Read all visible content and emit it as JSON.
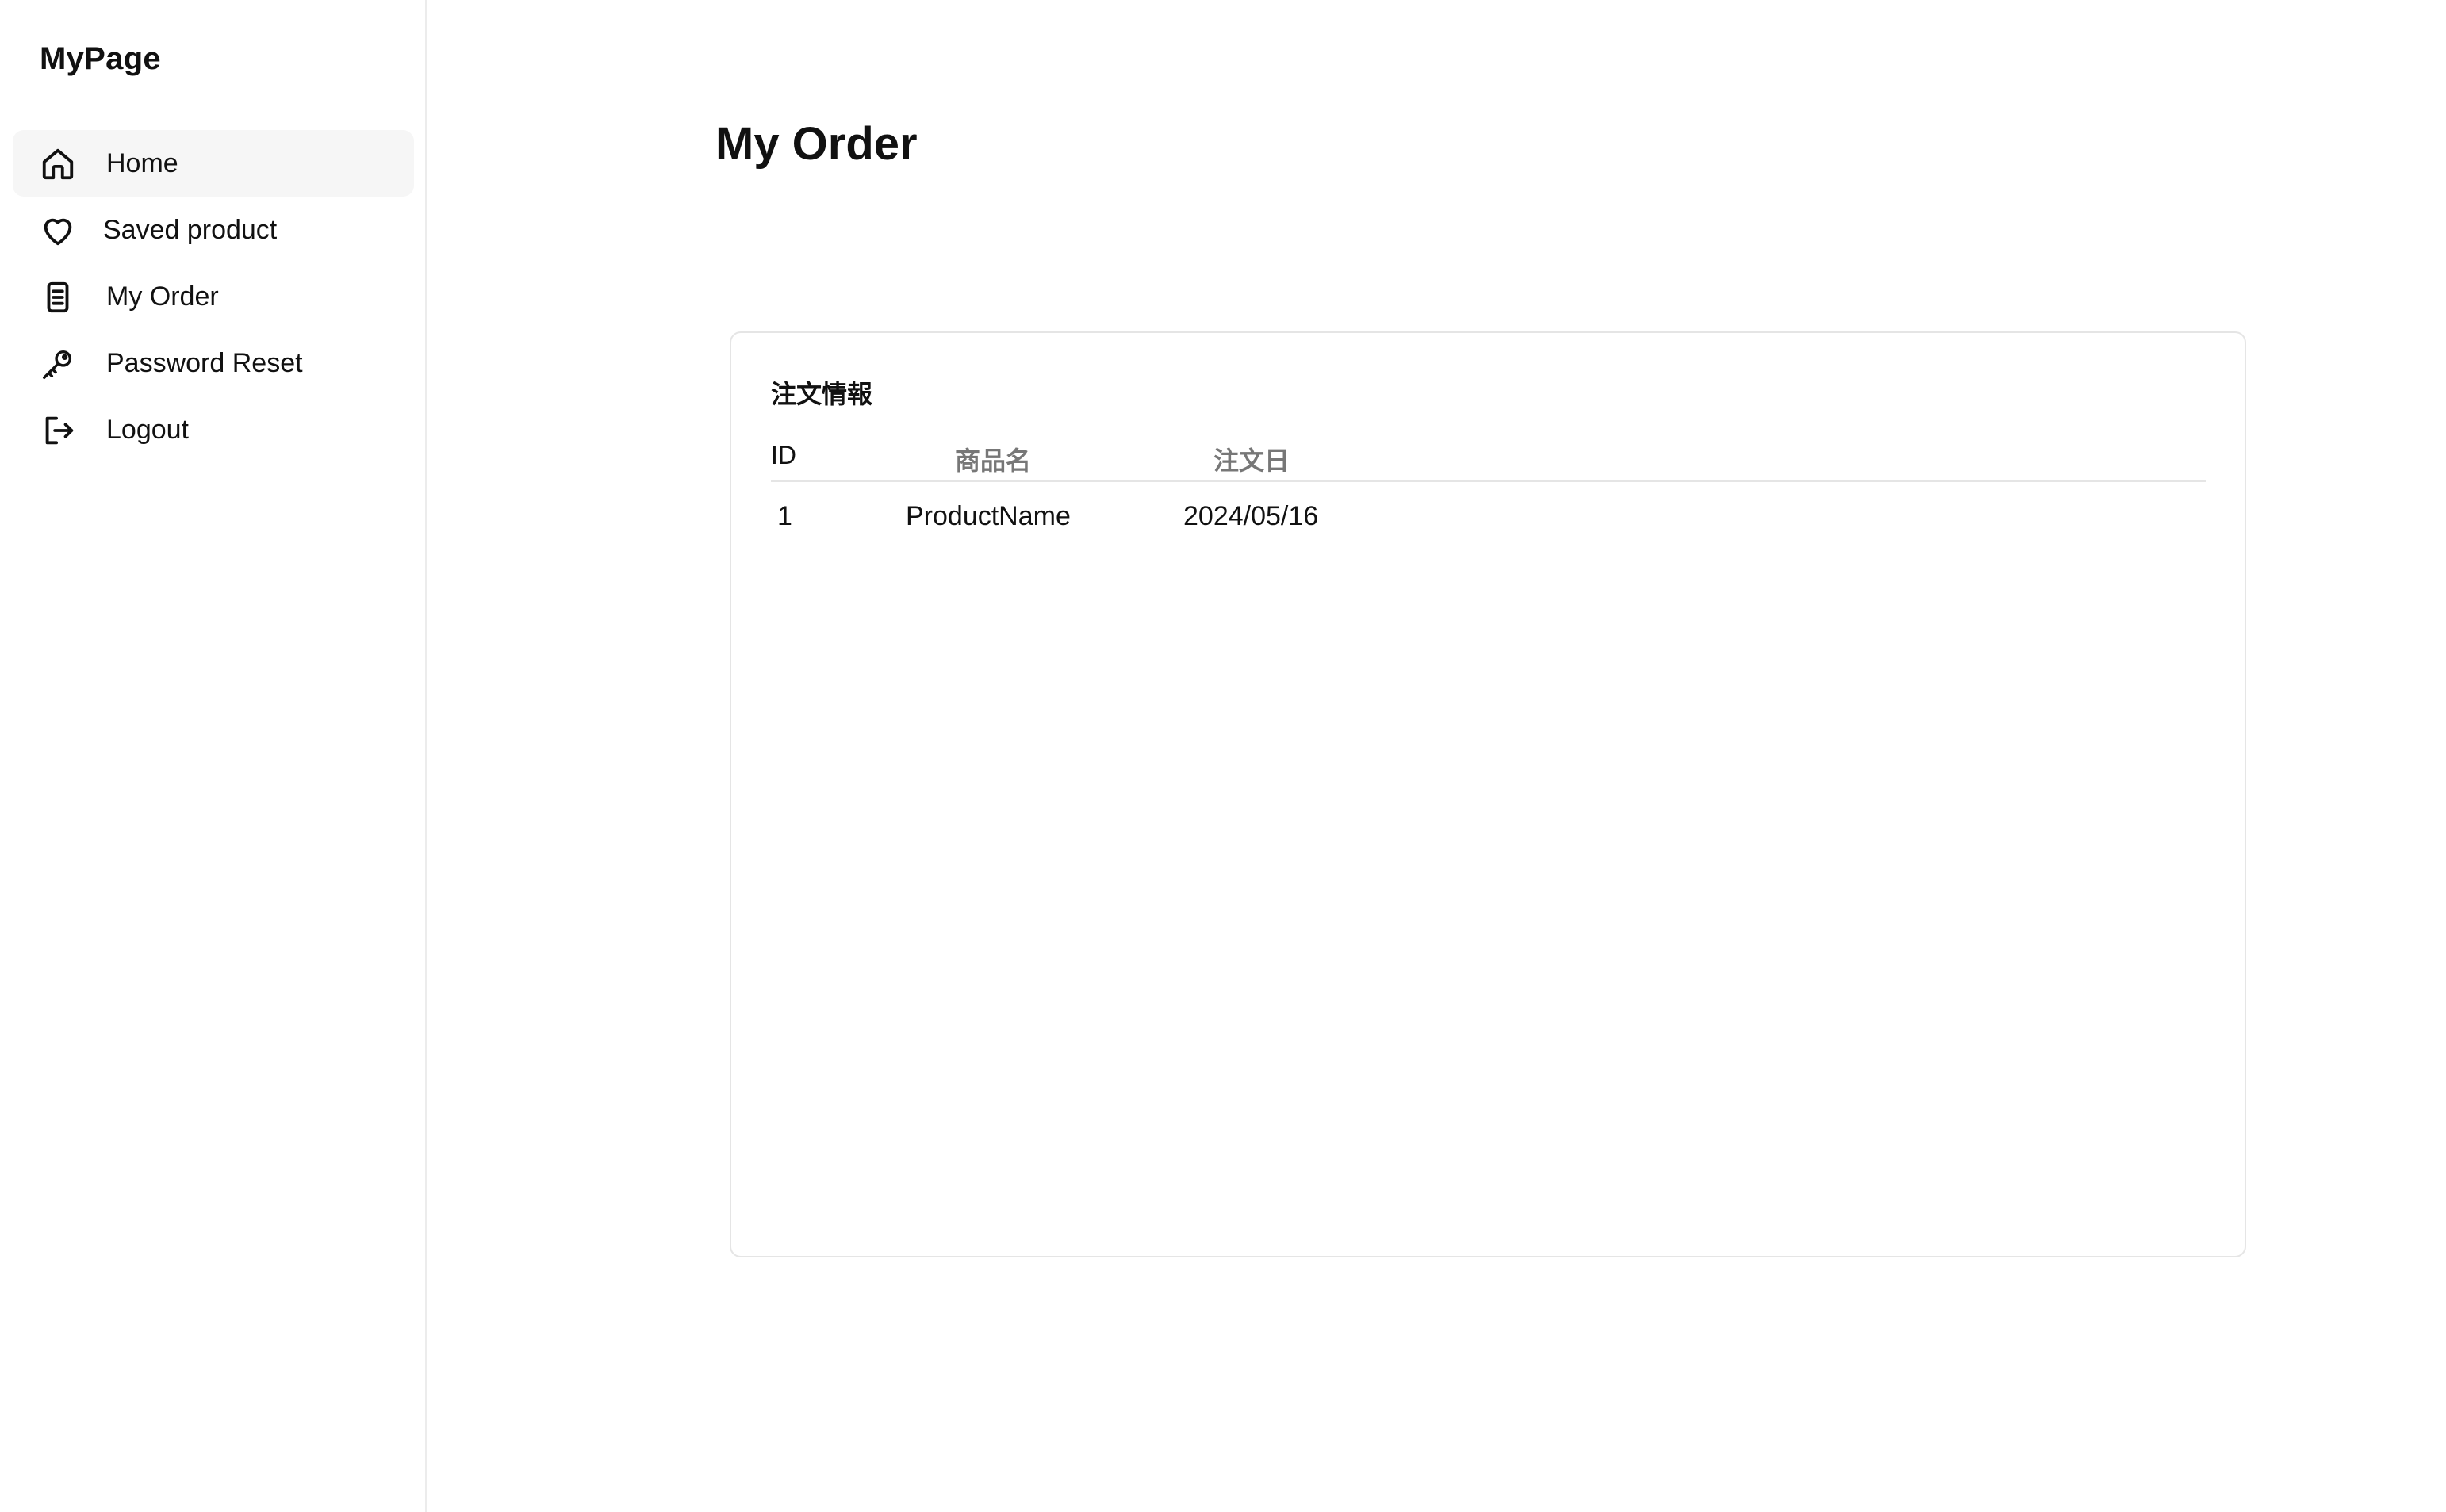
{
  "sidebar": {
    "brand": "MyPage",
    "items": [
      {
        "label": "Home",
        "icon": "home-icon"
      },
      {
        "label": "Saved product",
        "icon": "heart-icon"
      },
      {
        "label": "My Order",
        "icon": "document-icon"
      },
      {
        "label": "Password Reset",
        "icon": "key-icon"
      },
      {
        "label": "Logout",
        "icon": "logout-icon"
      }
    ],
    "active_index": 0
  },
  "main": {
    "title": "My Order",
    "card": {
      "title": "注文情報",
      "columns": [
        "ID",
        "商品名",
        "注文日"
      ],
      "rows": [
        {
          "id": "1",
          "name": "ProductName",
          "date": "2024/05/16"
        }
      ]
    }
  },
  "colors": {
    "active_bg": "#f6f6f6",
    "border": "#e5e5e5",
    "muted_header": "#777777",
    "text": "#111111"
  }
}
